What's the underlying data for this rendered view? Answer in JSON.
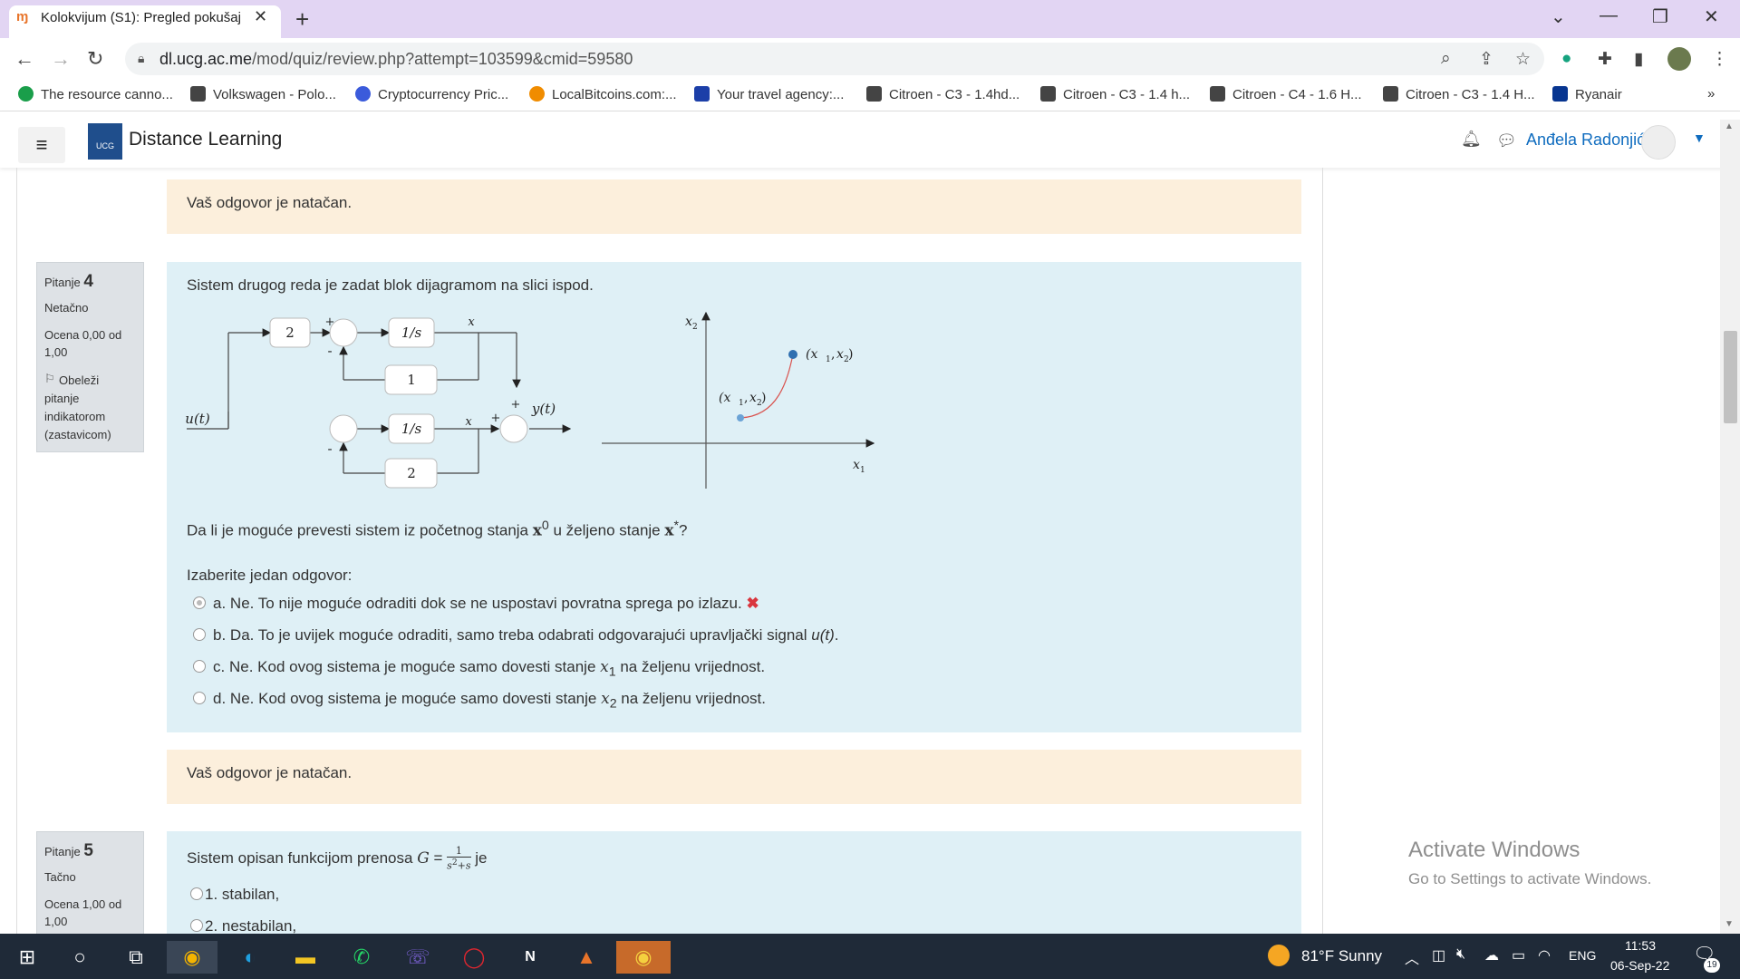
{
  "browser": {
    "tab_title": "Kolokvijum (S1): Pregled pokušaja",
    "url_host": "dl.ucg.ac.me",
    "url_path": "/mod/quiz/review.php?attempt=103599&cmid=59580",
    "bookmarks": [
      {
        "label": "The resource canno...",
        "color": "#1a9e4a"
      },
      {
        "label": "Volkswagen - Polo...",
        "color": "#333333"
      },
      {
        "label": "Cryptocurrency Pric...",
        "color": "#3b5bdb"
      },
      {
        "label": "LocalBitcoins.com:...",
        "color": "#f08c00"
      },
      {
        "label": "Your travel agency:...",
        "color": "#1c3fa8"
      },
      {
        "label": "Citroen - C3 - 1.4hd...",
        "color": "#333333"
      },
      {
        "label": "Citroen - C3 - 1.4 h...",
        "color": "#333333"
      },
      {
        "label": "Citroen - C4 - 1.6 H...",
        "color": "#333333"
      },
      {
        "label": "Citroen - C3 - 1.4 H...",
        "color": "#333333"
      },
      {
        "label": "Ryanair",
        "color": "#073590"
      }
    ],
    "more": "»"
  },
  "site": {
    "title": "Distance Learning",
    "logo_text": "UCG",
    "user_name": "Anđela Radonjić"
  },
  "feedback_top": "Vaš odgovor je natačan.",
  "q4": {
    "label": "Pitanje",
    "number": "4",
    "state": "Netačno",
    "grade": "Ocena 0,00 od 1,00",
    "flag": "Obeleži pitanje indikatorom (zastavicom)",
    "text": "Sistem drugog reda je zadat blok dijagramom na slici ispod.",
    "question": "Da li je moguće prevesti sistem iz početnog stanja",
    "question_mid": "u željeno stanje",
    "question_end": "?",
    "prompt": "Izaberite jedan odgovor:",
    "answers": [
      {
        "prefix": "a.",
        "text": "Ne. To nije moguće odraditi dok se ne uspostavi povratna sprega po izlazu.",
        "selected": true
      },
      {
        "prefix": "b.",
        "text": "Da. To je uvijek moguće odraditi, samo treba odabrati odgovarajući upravljački signal",
        "suffix_math": "u(t)",
        "suffix": ".",
        "selected": false
      },
      {
        "prefix": "c.",
        "text": "Ne. Kod ovog sistema je moguće samo dovesti stanje",
        "math": "x",
        "sub": "1",
        "after": "na željenu vrijednost.",
        "selected": false
      },
      {
        "prefix": "d.",
        "text": "Ne. Kod ovog sistema je moguće samo dovesti stanje",
        "math": "x",
        "sub": "2",
        "after": "na željenu vrijednost.",
        "selected": false
      }
    ],
    "feedback": "Vaš odgovor je natačan.",
    "diagram": {
      "gain_top": "2",
      "int_top": "1/s",
      "fb_top": "1",
      "int_bottom": "1/s",
      "fb_bottom": "2",
      "input": "u(t)",
      "output": "y(t)",
      "x1": "x",
      "x2": "x",
      "plus": "+",
      "minus": "-"
    },
    "phase": {
      "axis_x": "x",
      "axis_y": "x",
      "start": "(x",
      "target": "(x"
    }
  },
  "q5": {
    "label": "Pitanje",
    "number": "5",
    "state": "Tačno",
    "grade": "Ocena 1,00 od 1,00",
    "text": "Sistem opisan funkcijom prenosa",
    "text_end": "je",
    "answers": [
      "1. stabilan,",
      "2. nestabilan,"
    ]
  },
  "watermark": {
    "title": "Activate Windows",
    "subtitle": "Go to Settings to activate Windows."
  },
  "taskbar": {
    "weather": "81°F  Sunny",
    "lang": "ENG",
    "time": "11:53",
    "date": "06-Sep-22",
    "notif_count": "19"
  }
}
